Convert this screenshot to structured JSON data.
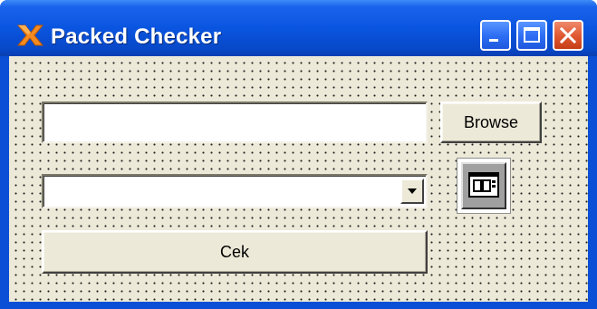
{
  "window": {
    "title": "Packed Checker",
    "title_color": "#ffffff",
    "titlebar_color": "#0a55e0",
    "close_button_color": "#e15a33",
    "client_background": "#ece9d8",
    "app_icon": "orange-x-logo-icon"
  },
  "caption_buttons": {
    "minimize_icon": "minimize-icon",
    "maximize_icon": "maximize-icon",
    "close_icon": "close-icon"
  },
  "form": {
    "path_input": {
      "value": "",
      "placeholder": ""
    },
    "browse_label": "Browse",
    "combo": {
      "selected": "",
      "arrow_icon": "chevron-down-icon"
    },
    "tool_icon": "combobox-control-icon",
    "cek_label": "Cek"
  }
}
